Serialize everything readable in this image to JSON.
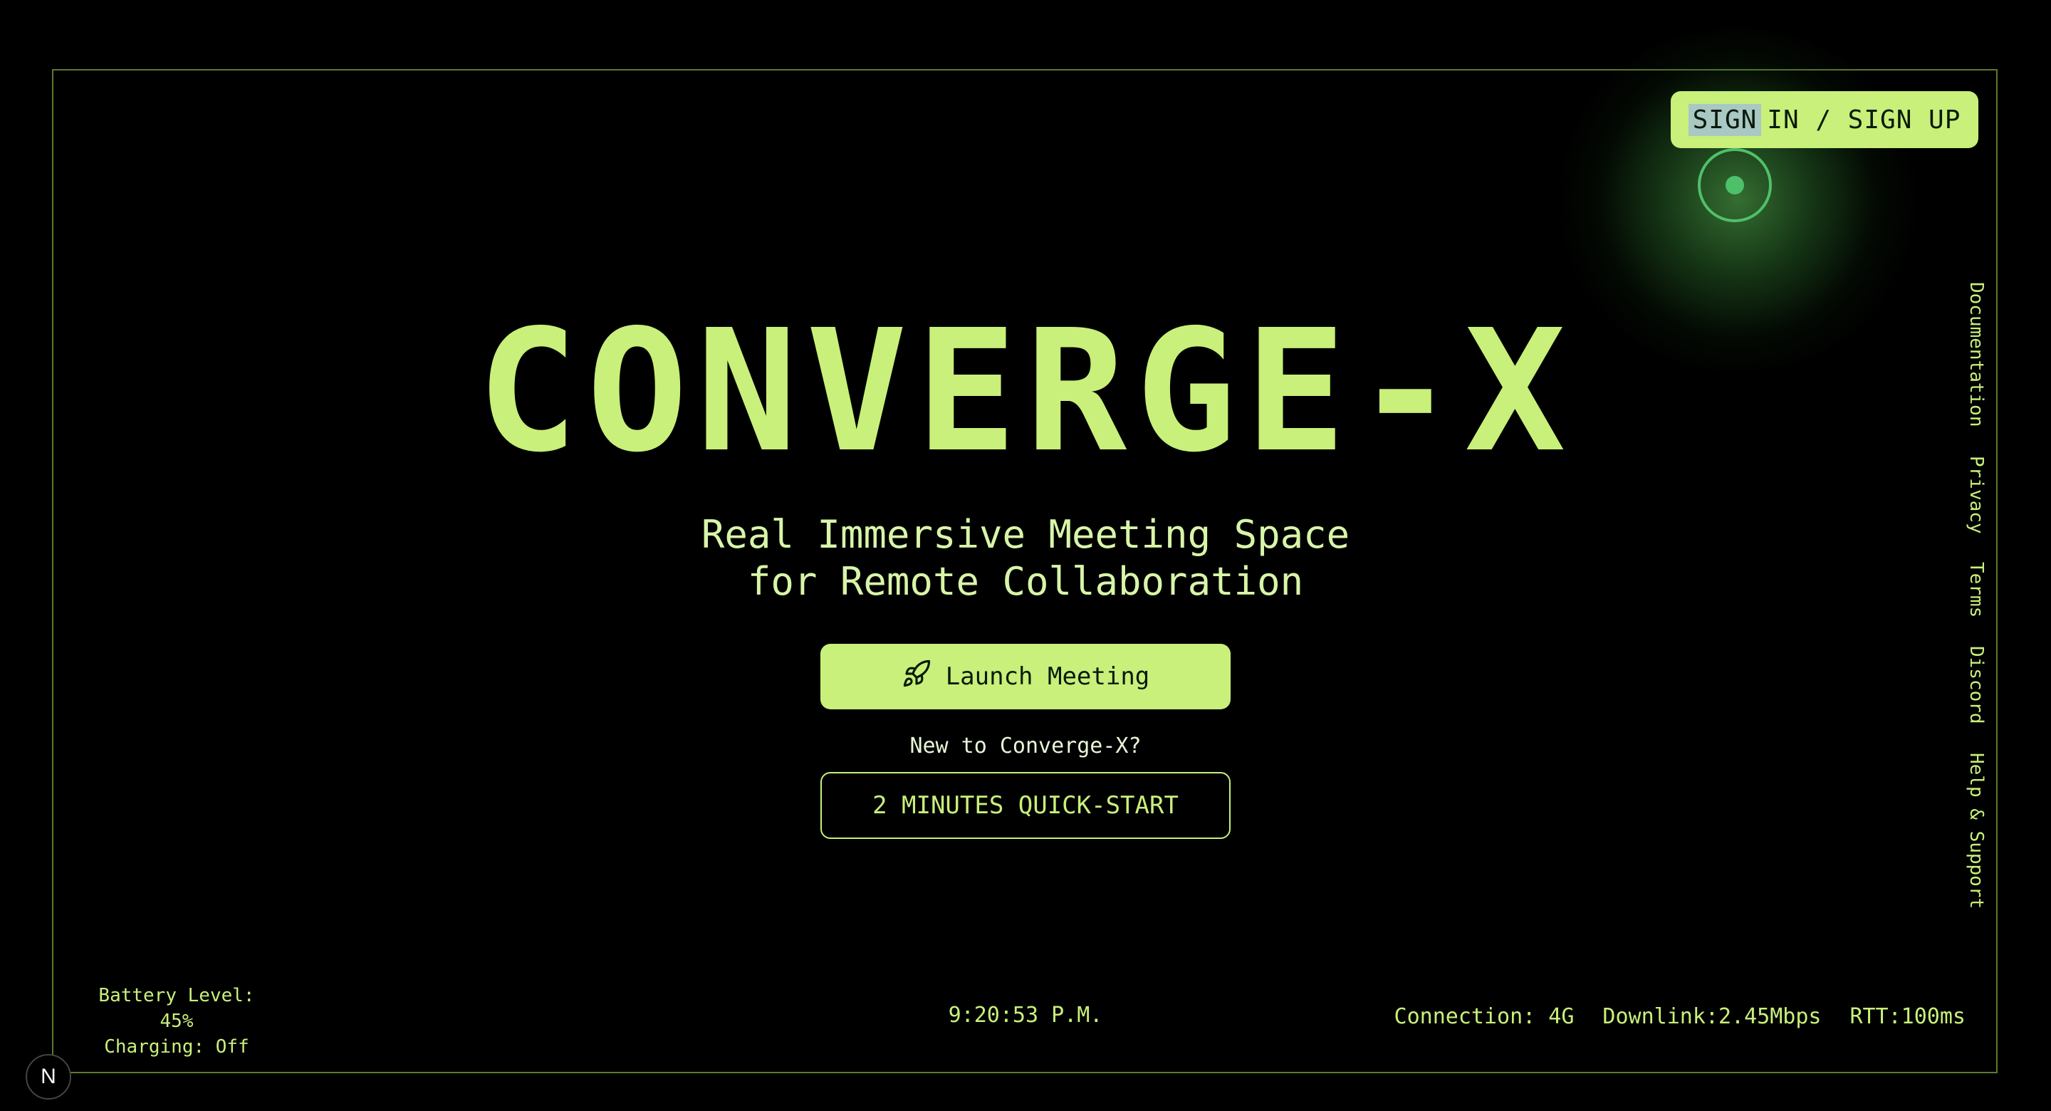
{
  "header": {
    "signin_highlight": "SIGN",
    "signin_rest": "IN / SIGN UP"
  },
  "hero": {
    "title": "CONVERGE-X",
    "subtitle_line1": "Real Immersive Meeting Space",
    "subtitle_line2": "for Remote Collaboration"
  },
  "actions": {
    "launch_label": "Launch Meeting",
    "launch_icon": "rocket-icon",
    "new_to_text": "New to Converge-X?",
    "quickstart_label": "2 MINUTES QUICK-START"
  },
  "side_nav": {
    "items": [
      {
        "label": "Documentation"
      },
      {
        "label": "Privacy"
      },
      {
        "label": "Terms"
      },
      {
        "label": "Discord"
      },
      {
        "label": "Help & Support"
      }
    ]
  },
  "status": {
    "battery_level": "Battery Level: 45%",
    "charging": "Charging: Off",
    "clock": "9:20:53 P.M.",
    "connection": "Connection: 4G",
    "downlink": "Downlink:2.45Mbps",
    "rtt": "RTT:100ms"
  },
  "badge": {
    "letter": "N"
  },
  "colors": {
    "accent": "#c8f07a",
    "background": "#000000",
    "cursor": "#4fc06a"
  }
}
